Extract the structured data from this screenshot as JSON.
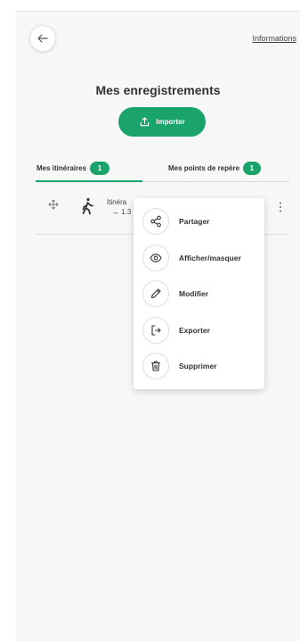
{
  "header": {
    "back_icon": "arrow-left-icon",
    "info_link": "Informations"
  },
  "page": {
    "title": "Mes enregistrements",
    "import_label": "Importer",
    "import_icon": "upload-icon"
  },
  "tabs": [
    {
      "label": "Mes itinéraires",
      "count": "1",
      "active": true
    },
    {
      "label": "Mes points de repère",
      "count": "1",
      "active": false
    }
  ],
  "itinerary": {
    "name": "Itinéra",
    "distance": "↔ 1.3",
    "icons": [
      "drag-handle-icon",
      "walking-person-icon",
      "more-vertical-icon"
    ]
  },
  "menu": {
    "items": [
      {
        "label": "Partager",
        "icon": "share-icon"
      },
      {
        "label": "Afficher/masquer",
        "icon": "eye-icon"
      },
      {
        "label": "Modifier",
        "icon": "pencil-icon"
      },
      {
        "label": "Exporter",
        "icon": "export-icon"
      },
      {
        "label": "Supprimer",
        "icon": "trash-icon"
      }
    ]
  },
  "colors": {
    "accent": "#1aa36a",
    "panel_background": "#f7f7f7"
  }
}
